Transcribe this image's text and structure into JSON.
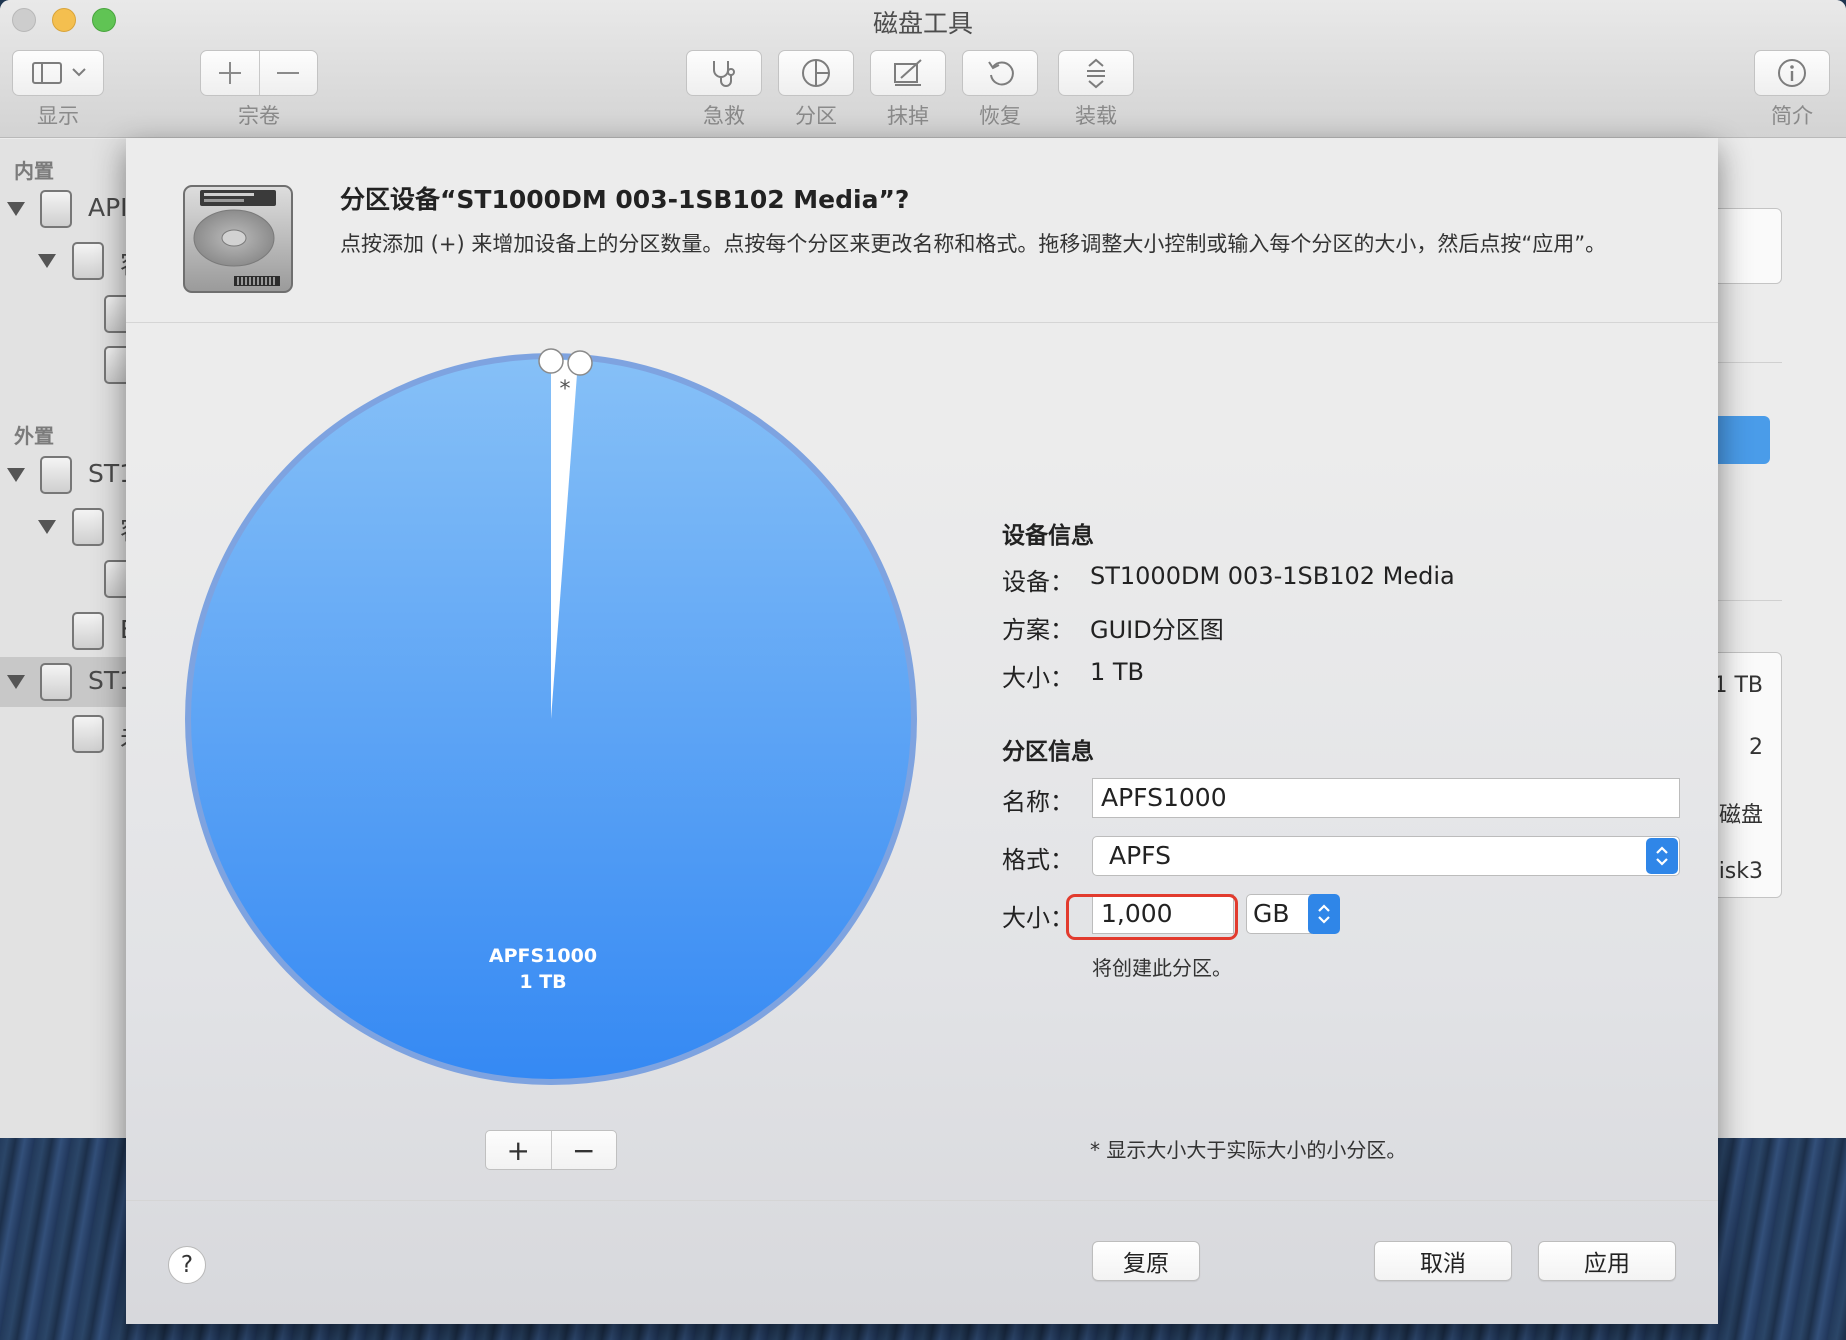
{
  "window": {
    "title": "磁盘工具"
  },
  "toolbar": {
    "view_label": "显示",
    "volume_label": "宗卷",
    "first_aid_label": "急救",
    "partition_label": "分区",
    "erase_label": "抹掉",
    "restore_label": "恢复",
    "mount_label": "装载",
    "info_label": "简介"
  },
  "sidebar": {
    "internal_heading": "内置",
    "external_heading": "外置",
    "items": [
      {
        "label": "API"
      },
      {
        "label": "容"
      },
      {
        "label": ""
      },
      {
        "label": ""
      },
      {
        "label": "ST1"
      },
      {
        "label": "容"
      },
      {
        "label": ""
      },
      {
        "label": "E"
      },
      {
        "label": "ST1"
      },
      {
        "label": "未"
      }
    ]
  },
  "detail_panel": {
    "values": [
      "1 TB",
      "2",
      "磁盘",
      "isk3"
    ]
  },
  "sheet": {
    "title": "分区设备“ST1000DM 003-1SB102 Media”?",
    "description": "点按添加 (+) 来增加设备上的分区数量。点按每个分区来更改名称和格式。拖移调整大小控制或输入每个分区的大小，然后点按“应用”。",
    "pie": {
      "partition_name": "APFS1000",
      "partition_size": "1 TB",
      "small_marker": "*",
      "color": "#3d8ff0"
    },
    "add_button": "+",
    "remove_button": "−",
    "device_info": {
      "heading": "设备信息",
      "device_label": "设备：",
      "device_value": "ST1000DM 003-1SB102 Media",
      "scheme_label": "方案：",
      "scheme_value": "GUID分区图",
      "size_label": "大小：",
      "size_value": "1 TB"
    },
    "partition_info": {
      "heading": "分区信息",
      "name_label": "名称：",
      "name_value": "APFS1000",
      "format_label": "格式：",
      "format_value": "APFS",
      "size_label": "大小：",
      "size_value": "1,000",
      "size_unit": "GB",
      "status": "将创建此分区。"
    },
    "footnote": "* 显示大小大于实际大小的小分区。",
    "buttons": {
      "revert": "复原",
      "cancel": "取消",
      "apply": "应用"
    },
    "help": "?"
  }
}
